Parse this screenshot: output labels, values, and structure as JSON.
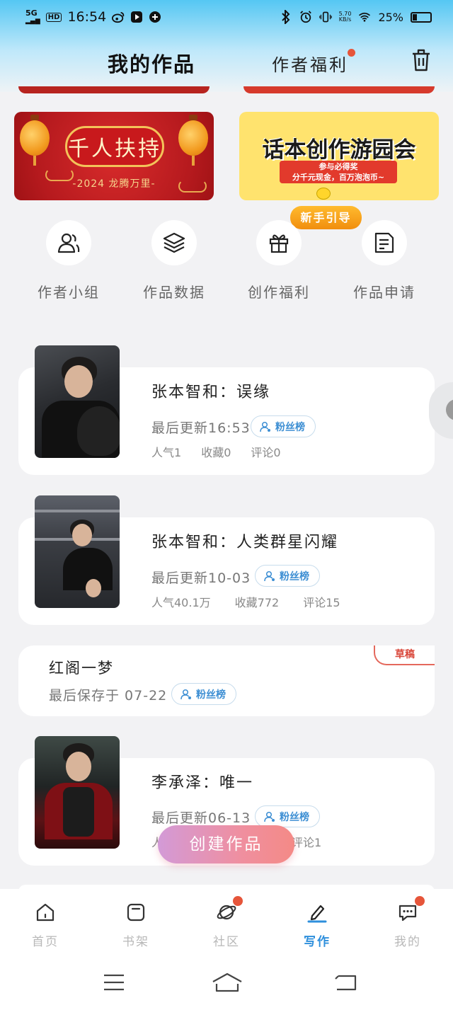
{
  "status": {
    "time": "16:54",
    "net_type": "5G",
    "hd": "HD",
    "speed_value": "5.70",
    "speed_unit": "KB/s",
    "battery": "25%"
  },
  "header": {
    "tab_mywork": "我的作品",
    "tab_welfare": "作者福利"
  },
  "banners": {
    "left": {
      "main": "千人扶持",
      "sub": "-2024 龙腾万里-"
    },
    "right": {
      "main": "话本创作游园会",
      "line1": "参与必得奖",
      "line2": "分千元现金，百万泡泡币~"
    },
    "guide": "新手引导"
  },
  "quick_actions": [
    {
      "label": "作者小组",
      "icon": "users-icon"
    },
    {
      "label": "作品数据",
      "icon": "layers-icon"
    },
    {
      "label": "创作福利",
      "icon": "gift-icon"
    },
    {
      "label": "作品申请",
      "icon": "document-icon"
    }
  ],
  "works": [
    {
      "title": "张本智和：误缘",
      "updated": "最后更新16:53",
      "fan_label": "粉丝榜",
      "stats": [
        "人气1",
        "收藏0",
        "评论0"
      ]
    },
    {
      "title": "张本智和：人类群星闪耀",
      "updated": "最后更新10-03",
      "fan_label": "粉丝榜",
      "stats": [
        "人气40.1万",
        "收藏772",
        "评论15"
      ]
    },
    {
      "title": "红阁一梦",
      "updated": "最后保存于 07-22",
      "fan_label": "粉丝榜",
      "badge": "草稿"
    },
    {
      "title": "李承泽：唯一",
      "updated": "最后更新06-13",
      "fan_label": "粉丝榜",
      "stats_left": "人",
      "stats_right": "评论1"
    }
  ],
  "create_button": "创建作品",
  "bottom_nav": [
    {
      "label": "首页",
      "icon": "home-icon",
      "active": false
    },
    {
      "label": "书架",
      "icon": "bookshelf-icon",
      "active": false
    },
    {
      "label": "社区",
      "icon": "planet-icon",
      "active": false,
      "dot": true
    },
    {
      "label": "写作",
      "icon": "pen-icon",
      "active": true
    },
    {
      "label": "我的",
      "icon": "chat-bubble-icon",
      "active": false,
      "dot": true
    }
  ],
  "colors": {
    "accent_blue": "#2e8fdc",
    "dot_red": "#e6553a",
    "draft_red": "#d9473a"
  }
}
